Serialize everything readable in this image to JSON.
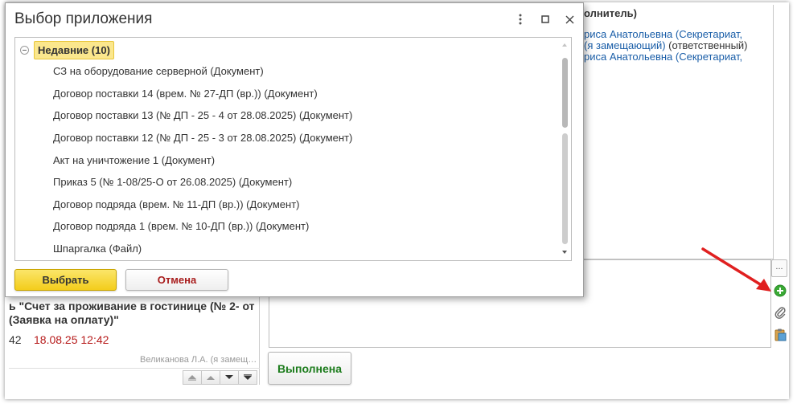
{
  "dialog": {
    "title": "Выбор приложения",
    "group_label": "Недавние (10)",
    "items": [
      "СЗ на оборудование серверной (Документ)",
      "Договор поставки 14 (врем. № 27-ДП (вр.)) (Документ)",
      "Договор поставки 13 (№ ДП - 25 - 4 от 28.08.2025) (Документ)",
      "Договор поставки 12 (№ ДП - 25 - 3 от 28.08.2025) (Документ)",
      "Акт на уничтожение 1 (Документ)",
      "Приказ 5 (№ 1-08/25-О от 26.08.2025) (Документ)",
      "Договор подряда (врем. № 11-ДП (вр.)) (Документ)",
      "Договор подряда 1 (врем. № 10-ДП (вр.)) (Документ)",
      "Шпаргалка (Файл)"
    ],
    "select_label": "Выбрать",
    "cancel_label": "Отмена",
    "icons": {
      "menu": "more-vertical-icon",
      "maximize": "maximize-icon",
      "close": "close-icon"
    }
  },
  "background": {
    "header_fragment": "олнитель)",
    "lines": [
      {
        "link": "риса Анатольевна (Секретариат,",
        "plain": ""
      },
      {
        "link": "(я замещающий)",
        "plain": " (ответственный)"
      },
      {
        "link": "риса Анатольевна (Секретариат,",
        "plain": ""
      }
    ],
    "ellipsis_label": "...",
    "done_label": "Выполнена",
    "task_title": "ь \"Счет за проживание в гостинице (№ 2- от (Заявка на оплату)\"",
    "task_number": "42",
    "task_date": "18.08.25 12:42",
    "task_author": "Великанова Л.А. (я замещающий)",
    "side_icons": [
      "add-circle-icon",
      "paperclip-icon",
      "clipboard-icon"
    ]
  },
  "colors": {
    "accent_yellow": "#f5d21f",
    "link_blue": "#1a5ea8",
    "done_green": "#1c7c1c",
    "cancel_red": "#a81c1c",
    "annotation_red": "#e02020"
  }
}
